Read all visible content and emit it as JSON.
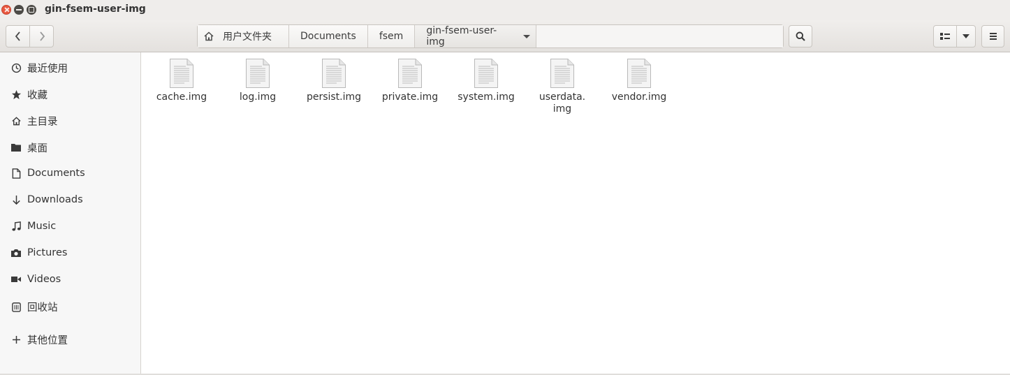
{
  "window": {
    "title": "gin-fsem-user-img"
  },
  "header": {
    "back_icon": "chevron-left-icon",
    "forward_icon": "chevron-right-icon",
    "breadcrumbs": [
      {
        "label": "用户文件夹",
        "icon": "home-icon"
      },
      {
        "label": "Documents"
      },
      {
        "label": "fsem"
      },
      {
        "label": "gin-fsem-user-img"
      }
    ],
    "search_icon": "search-icon",
    "view_icon": "list-view-icon",
    "view_dropdown_icon": "chevron-down-icon",
    "menu_icon": "hamburger-menu-icon"
  },
  "sidebar": {
    "items": [
      {
        "label": "最近使用",
        "icon": "clock-icon"
      },
      {
        "label": "收藏",
        "icon": "star-icon"
      },
      {
        "label": "主目录",
        "icon": "home-icon"
      },
      {
        "label": "桌面",
        "icon": "folder-icon"
      },
      {
        "label": "Documents",
        "icon": "document-icon"
      },
      {
        "label": "Downloads",
        "icon": "download-arrow-icon"
      },
      {
        "label": "Music",
        "icon": "music-note-icon"
      },
      {
        "label": "Pictures",
        "icon": "camera-icon"
      },
      {
        "label": "Videos",
        "icon": "video-icon"
      },
      {
        "label": "回收站",
        "icon": "trash-icon"
      },
      {
        "label": "其他位置",
        "icon": "plus-icon"
      }
    ]
  },
  "files": [
    {
      "name": "cache.img",
      "icon": "text-file-icon"
    },
    {
      "name": "log.img",
      "icon": "text-file-icon"
    },
    {
      "name": "persist.img",
      "icon": "text-file-icon"
    },
    {
      "name": "private.img",
      "icon": "text-file-icon"
    },
    {
      "name": "system.img",
      "icon": "text-file-icon"
    },
    {
      "name": "userdata.\nimg",
      "icon": "text-file-icon"
    },
    {
      "name": "vendor.img",
      "icon": "text-file-icon"
    }
  ]
}
